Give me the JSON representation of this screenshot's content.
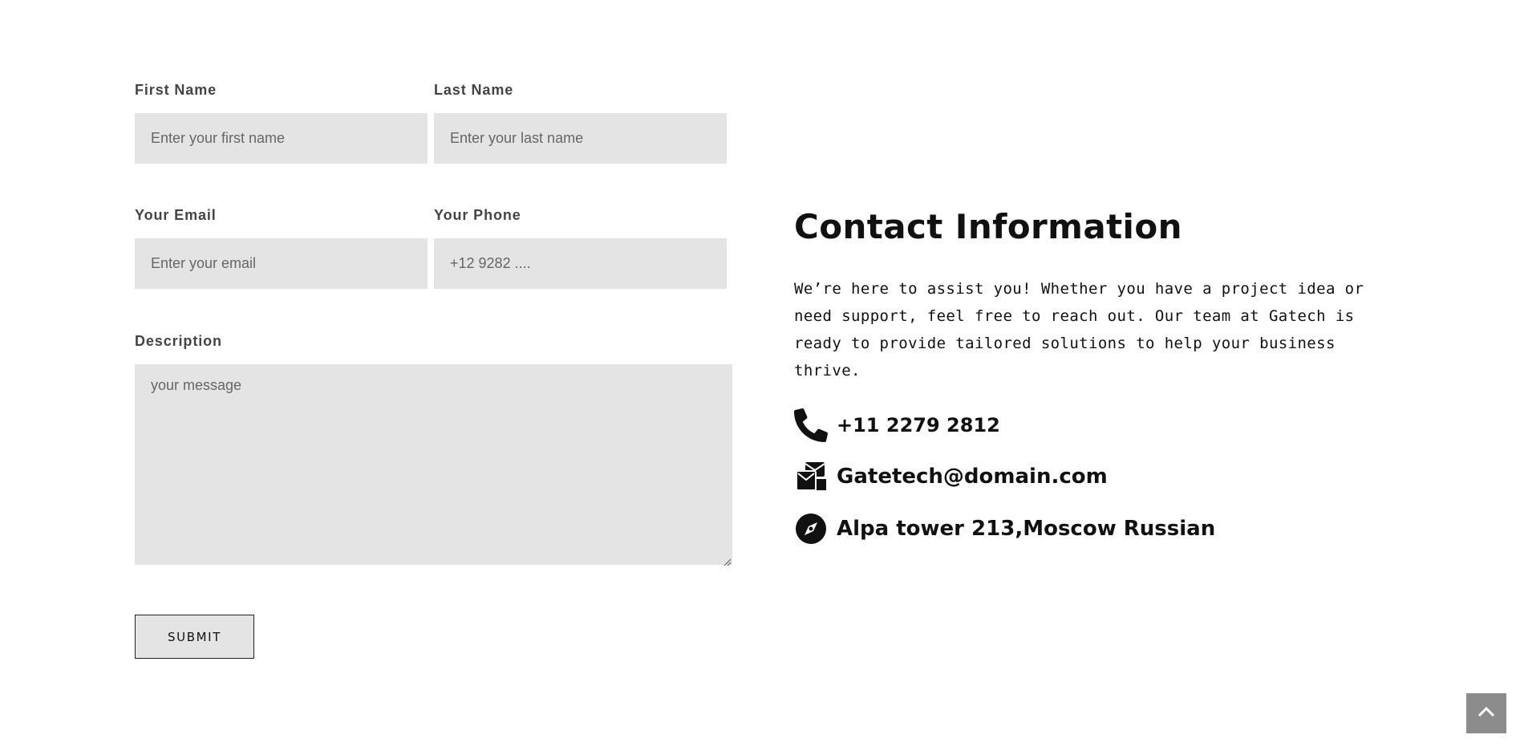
{
  "form": {
    "first_name": {
      "label": "First Name",
      "placeholder": "Enter your first name"
    },
    "last_name": {
      "label": "Last Name",
      "placeholder": "Enter your last name"
    },
    "email": {
      "label": "Your Email",
      "placeholder": "Enter your email"
    },
    "phone": {
      "label": "Your Phone",
      "placeholder": "+12 9282 ...."
    },
    "description": {
      "label": "Description",
      "placeholder": "your message"
    },
    "submit_label": "SUBMIT"
  },
  "contact": {
    "title": "Contact Information",
    "text": "We’re here to assist you! Whether you have a project idea or need support, feel free to reach out. Our team at Gatech is ready to provide tailored solutions to help your business thrive.",
    "items": [
      {
        "icon": "phone-icon",
        "value": "+11 2279 2812"
      },
      {
        "icon": "mail-icon",
        "value": "Gatetech@domain.com"
      },
      {
        "icon": "compass-icon",
        "value": "Alpa tower 213,Moscow Russian"
      }
    ]
  },
  "back_to_top": {
    "icon": "chevron-up-icon"
  }
}
